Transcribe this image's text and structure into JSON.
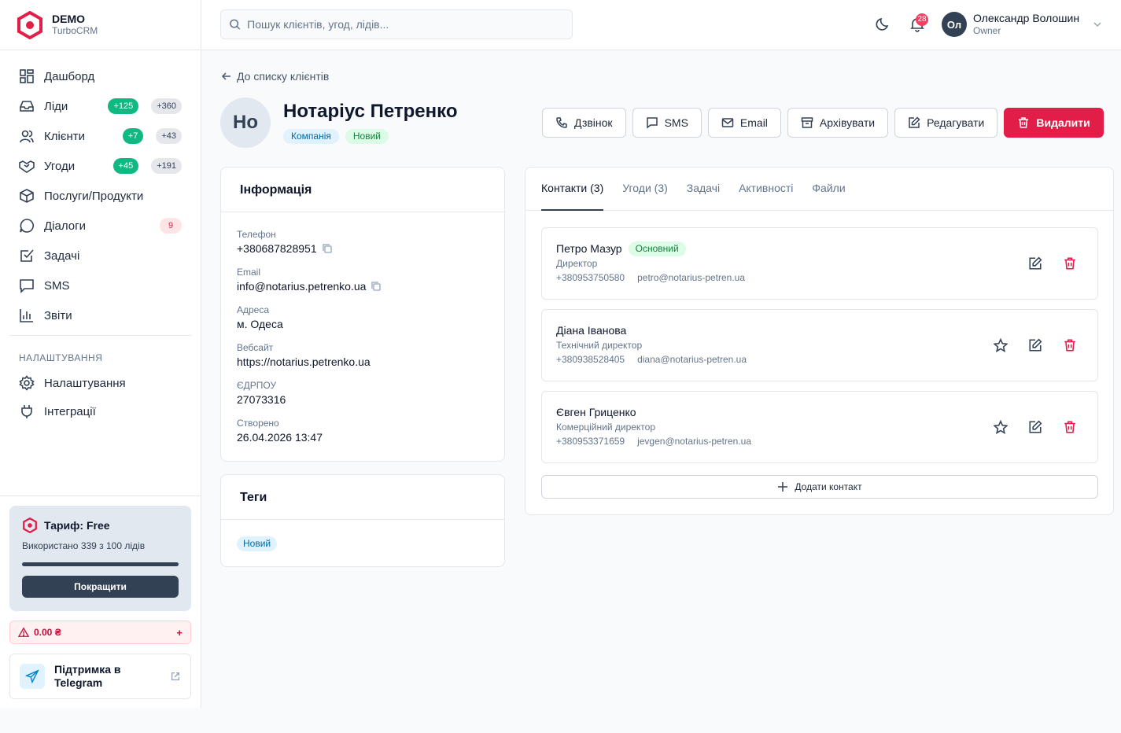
{
  "brand": {
    "title": "DEMO",
    "subtitle": "TurboCRM"
  },
  "search": {
    "placeholder": "Пошук клієнтів, угод, лідів..."
  },
  "notifications": {
    "count": "28"
  },
  "user": {
    "initials": "Ол",
    "name": "Олександр Волошин",
    "role": "Owner"
  },
  "nav": {
    "items": [
      {
        "label": "Дашборд",
        "icon": "dashboard-icon"
      },
      {
        "label": "Ліди",
        "icon": "inbox-icon",
        "badge_new": "+125",
        "badge_total": "+360"
      },
      {
        "label": "Клієнти",
        "icon": "users-icon",
        "badge_new": "+7",
        "badge_total": "+43"
      },
      {
        "label": "Угоди",
        "icon": "handshake-icon",
        "badge_new": "+45",
        "badge_total": "+191"
      },
      {
        "label": "Послуги/Продукти",
        "icon": "box-icon"
      },
      {
        "label": "Діалоги",
        "icon": "chat-icon",
        "badge_alert": "9"
      },
      {
        "label": "Задачі",
        "icon": "tasks-icon"
      },
      {
        "label": "SMS",
        "icon": "sms-icon"
      },
      {
        "label": "Звіти",
        "icon": "reports-icon"
      }
    ],
    "section_title": "НАЛАШТУВАННЯ",
    "settings_items": [
      {
        "label": "Налаштування",
        "icon": "gear-icon"
      },
      {
        "label": "Інтеграції",
        "icon": "plug-icon"
      }
    ]
  },
  "plan": {
    "title": "Тариф: Free",
    "usage": "Використано 339 з 100 лідів",
    "usage_fraction": 1.0,
    "upgrade_label": "Покращити",
    "balance": "0.00 ₴",
    "balance_add": "+"
  },
  "support": {
    "label": "Підтримка в Telegram"
  },
  "back_link": "До списку клієнтів",
  "client": {
    "initials": "Но",
    "name": "Нотаріус Петренко",
    "type_badge": "Компанія",
    "status_badge": "Новий"
  },
  "actions": {
    "call": "Дзвінок",
    "sms": "SMS",
    "email": "Email",
    "archive": "Архівувати",
    "edit": "Редагувати",
    "delete": "Видалити"
  },
  "info": {
    "title": "Інформація",
    "fields": [
      {
        "label": "Телефон",
        "value": "+380687828951"
      },
      {
        "label": "Email",
        "value": "info@notarius.petrenko.ua"
      },
      {
        "label": "Адреса",
        "value": "м. Одеса"
      },
      {
        "label": "Вебсайт",
        "value": "https://notarius.petrenko.ua"
      },
      {
        "label": "ЄДРПОУ",
        "value": "27073316"
      },
      {
        "label": "Створено",
        "value": "26.04.2026 13:47"
      }
    ]
  },
  "tags": {
    "title": "Теги",
    "items": [
      "Новий"
    ]
  },
  "tabs": [
    "Контакти (3)",
    "Угоди (3)",
    "Задачі",
    "Активності",
    "Файли"
  ],
  "contacts": [
    {
      "name": "Петро Мазур",
      "badge": "Основний",
      "role": "Директор",
      "phone": "+380953750580",
      "email": "petro@notarius-petren.ua"
    },
    {
      "name": "Діана Іванова",
      "role": "Технічний директор",
      "phone": "+380938528405",
      "email": "diana@notarius-petren.ua"
    },
    {
      "name": "Євген Гриценко",
      "role": "Комерційний директор",
      "phone": "+380953371659",
      "email": "jevgen@notarius-petren.ua"
    }
  ],
  "add_contact": "Додати контакт",
  "colors": {
    "accent": "#334155",
    "danger": "#e11d48",
    "success": "#10b981"
  }
}
